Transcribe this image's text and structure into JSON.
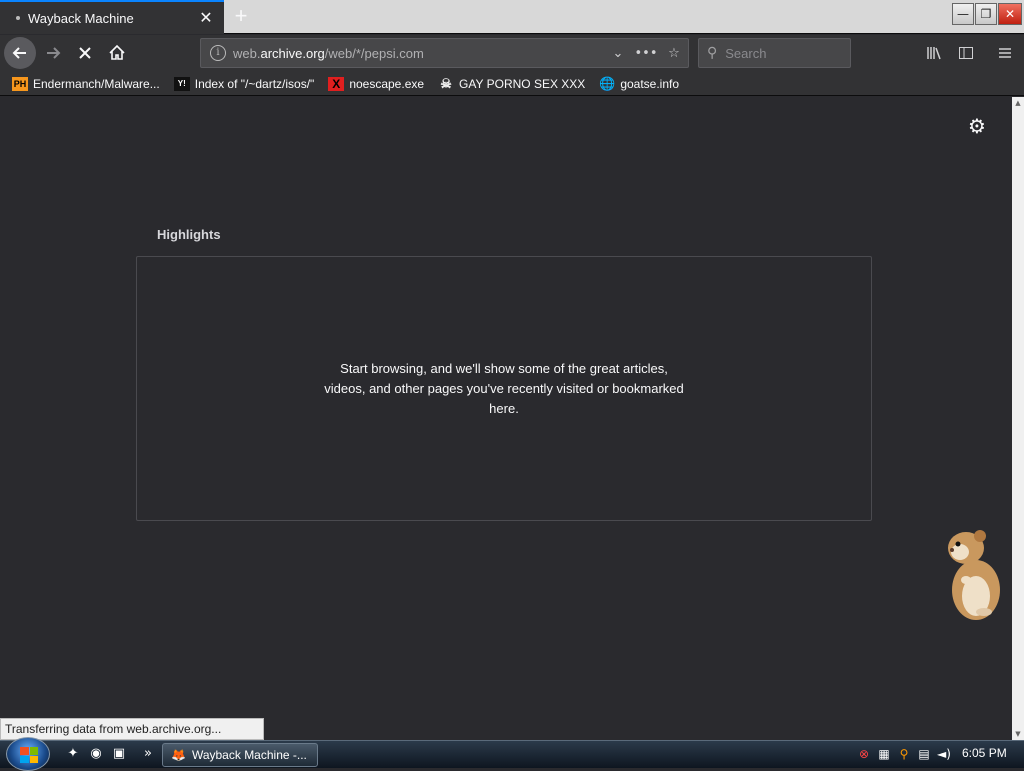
{
  "tab": {
    "title": "Wayback Machine",
    "close_glyph": "✕",
    "new_tab_glyph": "+"
  },
  "window_controls": {
    "minimize": "—",
    "restore": "❐",
    "close": "✕"
  },
  "toolbar": {
    "url_domain_prefix": "web.",
    "url_domain": "archive.org",
    "url_path": "/web/*/pepsi.com",
    "search_placeholder": "Search"
  },
  "bookmarks": [
    {
      "icon": "PH",
      "label": "Endermanch/Malware..."
    },
    {
      "icon": "Y!",
      "label": "Index of \"/~dartz/isos/\""
    },
    {
      "icon": "X",
      "label": "noescape.exe"
    },
    {
      "icon": "☠",
      "label": "GAY PORNO SEX XXX"
    },
    {
      "icon": "🌐",
      "label": "goatse.info"
    }
  ],
  "content": {
    "highlights_title": "Highlights",
    "highlights_message": "Start browsing, and we'll show some of the great articles, videos, and other pages you've recently visited or bookmarked here."
  },
  "status_bar": {
    "text": "Transferring data from web.archive.org..."
  },
  "taskbar": {
    "overflow_glyph": "»",
    "window_button_label": "Wayback Machine -...",
    "clock": "6:05 PM"
  },
  "colors": {
    "accent": "#0a84ff",
    "content_bg": "#2a2a2e",
    "toolbar_bg": "#323234"
  }
}
